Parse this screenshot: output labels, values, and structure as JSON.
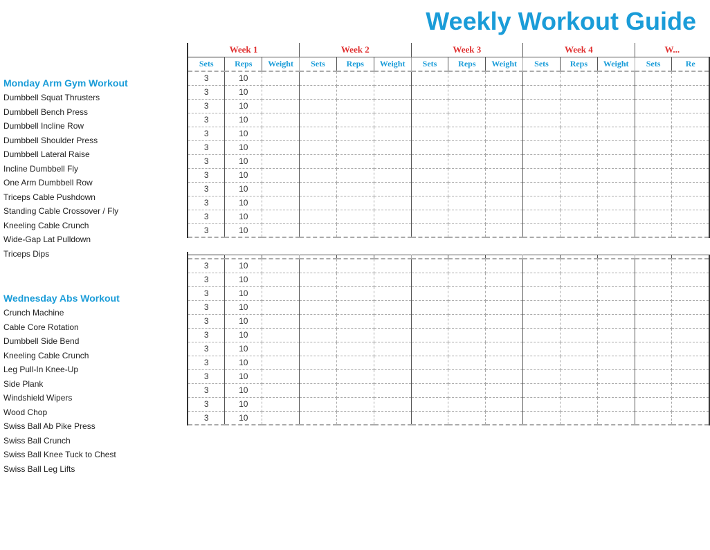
{
  "title": "Weekly Workout Guide",
  "sections": [
    {
      "id": "monday",
      "title": "Monday Arm Gym Workout",
      "exercises": [
        "Dumbbell Squat Thrusters",
        "Dumbbell Bench Press",
        "Dumbbell Incline Row",
        "Dumbbell Shoulder Press",
        "Dumbbell Lateral Raise",
        "Incline Dumbbell Fly",
        "One Arm Dumbbell Row",
        "Triceps Cable Pushdown",
        "Standing Cable Crossover / Fly",
        "Kneeling Cable Crunch",
        "Wide-Gap Lat Pulldown",
        "Triceps Dips"
      ]
    },
    {
      "id": "wednesday",
      "title": "Wednesday Abs Workout",
      "exercises": [
        "Crunch Machine",
        "Cable Core Rotation",
        "Dumbbell Side Bend",
        "Kneeling Cable Crunch",
        "Leg Pull-In Knee-Up",
        "Side Plank",
        "Windshield Wipers",
        "Wood Chop",
        "Swiss Ball Ab Pike Press",
        "Swiss Ball Crunch",
        "Swiss Ball Knee Tuck to Chest",
        "Swiss Ball Leg Lifts"
      ]
    }
  ],
  "weeks": [
    {
      "label": "Week 1",
      "colspan": 3
    },
    {
      "label": "Week 2",
      "colspan": 3
    },
    {
      "label": "Week 3",
      "colspan": 3
    },
    {
      "label": "Week 4",
      "colspan": 3
    },
    {
      "label": "W...",
      "colspan": 2
    }
  ],
  "col_headers": [
    "Sets",
    "Reps",
    "Weight",
    "Sets",
    "Reps",
    "Weight",
    "Sets",
    "Reps",
    "Weight",
    "Sets",
    "Reps",
    "Weight",
    "Sets",
    "Re"
  ],
  "default_sets": "3",
  "default_reps": "10"
}
